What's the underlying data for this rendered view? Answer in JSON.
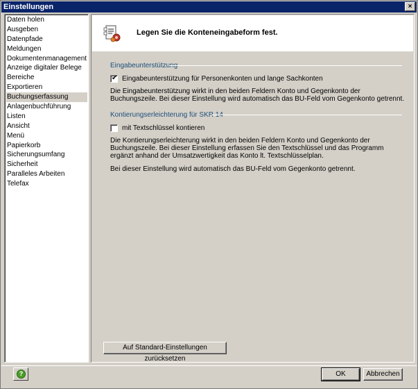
{
  "window": {
    "title": "Einstellungen",
    "close_glyph": "×"
  },
  "sidebar": {
    "items": [
      {
        "label": "Daten holen"
      },
      {
        "label": "Ausgeben"
      },
      {
        "label": "Datenpfade"
      },
      {
        "label": "Meldungen"
      },
      {
        "label": "Dokumentenmanagement"
      },
      {
        "label": "Anzeige digitaler Belege"
      },
      {
        "label": "Bereiche"
      },
      {
        "label": "Exportieren"
      },
      {
        "label": "Buchungserfassung",
        "selected": true
      },
      {
        "label": "Anlagenbuchführung"
      },
      {
        "label": "Listen"
      },
      {
        "label": "Ansicht"
      },
      {
        "label": "Menü"
      },
      {
        "label": "Papierkorb"
      },
      {
        "label": "Sicherungsumfang"
      },
      {
        "label": "Sicherheit"
      },
      {
        "label": "Paralleles Arbeiten"
      },
      {
        "label": "Telefax"
      }
    ]
  },
  "header": {
    "title": "Legen Sie die Konteneingabeform fest.",
    "icon": "settings-document-icon"
  },
  "group1": {
    "title": "Eingabeunterstützung",
    "checkbox_label": "Eingabeunterstützung für Personenkonten und lange Sachkonten",
    "checked": true,
    "description": "Die Eingabeunterstützung wirkt in den beiden Feldern Konto und Gegenkonto der Buchungszeile. Bei dieser Einstellung wird automatisch das BU-Feld vom Gegenkonto getrennt."
  },
  "group2": {
    "title": "Kontierungserleichterung für SKR 14",
    "checkbox_label": "mit Textschlüssel kontieren",
    "checked": false,
    "description": "Die Kontierungserleichterung wirkt in den beiden Feldern Konto und Gegenkonto der Buchungszeile. Bei dieser Einstellung erfassen Sie den Textschlüssel und das Programm ergänzt anhand der Umsatzwertigkeit das Konto lt. Textschlüsselplan.",
    "note": "Bei dieser Einstellung wird automatisch das BU-Feld vom Gegenkonto getrennt."
  },
  "buttons": {
    "reset": "Auf Standard-Einstellungen zurücksetzen",
    "ok": "OK",
    "cancel": "Abbrechen"
  },
  "help_glyph": "?",
  "colors": {
    "titlebar": "#0a246a",
    "window": "#d4d0c8",
    "group_title": "#1f4e79",
    "help": "#4a9d2a"
  }
}
